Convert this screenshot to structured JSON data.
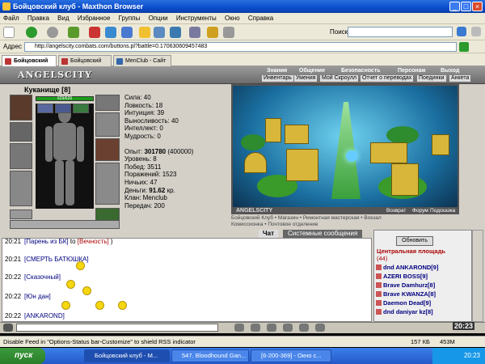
{
  "window": {
    "title": "Бойцовский клуб - Maxthon Browser",
    "min": "_",
    "max": "□",
    "close": "×"
  },
  "menu": [
    "Файл",
    "Правка",
    "Вид",
    "Избранное",
    "Группы",
    "Опции",
    "Инструменты",
    "Окно",
    "Справка"
  ],
  "toolbar": {
    "search_label": "Поиск"
  },
  "address": {
    "label": "Адрес",
    "url": "http://angelscity.combats.com/buttons.pl?battle=0.170630609457483"
  },
  "tabs": [
    "Бойцовский клу...",
    "Бойцовский клу...",
    "MenClub - Сайт к..."
  ],
  "game": {
    "logo": "ANGELSCITY",
    "nav_top": [
      "Знания",
      "Общение",
      "Безопасность",
      "Персонаж",
      "Выход"
    ],
    "nav_bottom": [
      "Инвентарь",
      "Умения",
      "Мой Скроулл",
      "Отчет о переводах",
      "Поединки",
      "Анкета"
    ],
    "character": {
      "name": "Куканище",
      "level": "[8]",
      "hp": "629/629",
      "stats": [
        "Сила: 40",
        "Ловкость: 18",
        "Интуиция: 39",
        "Выносливость: 40",
        "Интеллект: 0",
        "Мудрость: 0"
      ],
      "experience_label": "Опыт:",
      "experience": "301780",
      "experience_next": "(400000)",
      "level_line": "Уровень: 8",
      "wins": "Побед: 3511",
      "losses": "Поражений: 1523",
      "draws": "Ничьих: 47",
      "money_label": "Деньги:",
      "money": "91.62",
      "money_unit": "кр.",
      "clan": "Клан: Menclub",
      "transfers": "Передач: 200"
    },
    "scene": {
      "logo": "ANGELSCITY",
      "links": [
        "Возврат",
        "Форум",
        "Подсказка"
      ],
      "locations": [
        "Бойцовский Клуб",
        "Магазин",
        "Ремонтная мастерская",
        "Вокзал",
        "Комиссионка",
        "Почтовое отделение"
      ]
    },
    "chat_tabs": [
      "Чат",
      "Системные сообщения"
    ],
    "chat": [
      {
        "time": "20:21",
        "nick": "[Парень из БК]",
        "to": "to",
        "target": "[Вечность]",
        "tail": ")"
      },
      {
        "time": "20:21",
        "nick": "[СМЕРТЬ БАТЮШКА]",
        "to": "",
        "target": "",
        "tail": ""
      },
      {
        "time": "20:22",
        "nick": "[Сказочный]",
        "to": "",
        "target": "",
        "tail": ""
      },
      {
        "time": "20:22",
        "nick": "[Юн дан]",
        "to": "",
        "target": "",
        "tail": ""
      },
      {
        "time": "20:22",
        "nick": "[ANKAROND]",
        "to": "",
        "target": "",
        "tail": ""
      }
    ],
    "online": {
      "refresh": "Обновить",
      "room": "Центральная площадь",
      "count": "(44)",
      "users": [
        {
          "name": "dnd ANKAROND",
          "level": "[9]"
        },
        {
          "name": "AZERI BOSS",
          "level": "[9]"
        },
        {
          "name": "Brave Damhurz",
          "level": "[8]"
        },
        {
          "name": "Brave KWANZA",
          "level": "[8]"
        },
        {
          "name": "Daemon Dead",
          "level": "[9]"
        },
        {
          "name": "dnd daniyar kz",
          "level": "[8]"
        }
      ]
    },
    "clock": "20:23"
  },
  "status": {
    "text": "Disable Feed in \"Options-Status bar-Customize\" to shield RSS indicator",
    "speed": "157 КБ",
    "mem": "453М"
  },
  "taskbar": {
    "start": "пуск",
    "tasks": [
      "Бойцовский клуб - M...",
      "547. Bloodhound Gan...",
      "[6-200-369] - Окно с..."
    ],
    "time": "20:23"
  },
  "colors": {
    "titlebar": "#0a4ccb",
    "taskbar": "#2558c9",
    "start": "#2a7f2a"
  }
}
